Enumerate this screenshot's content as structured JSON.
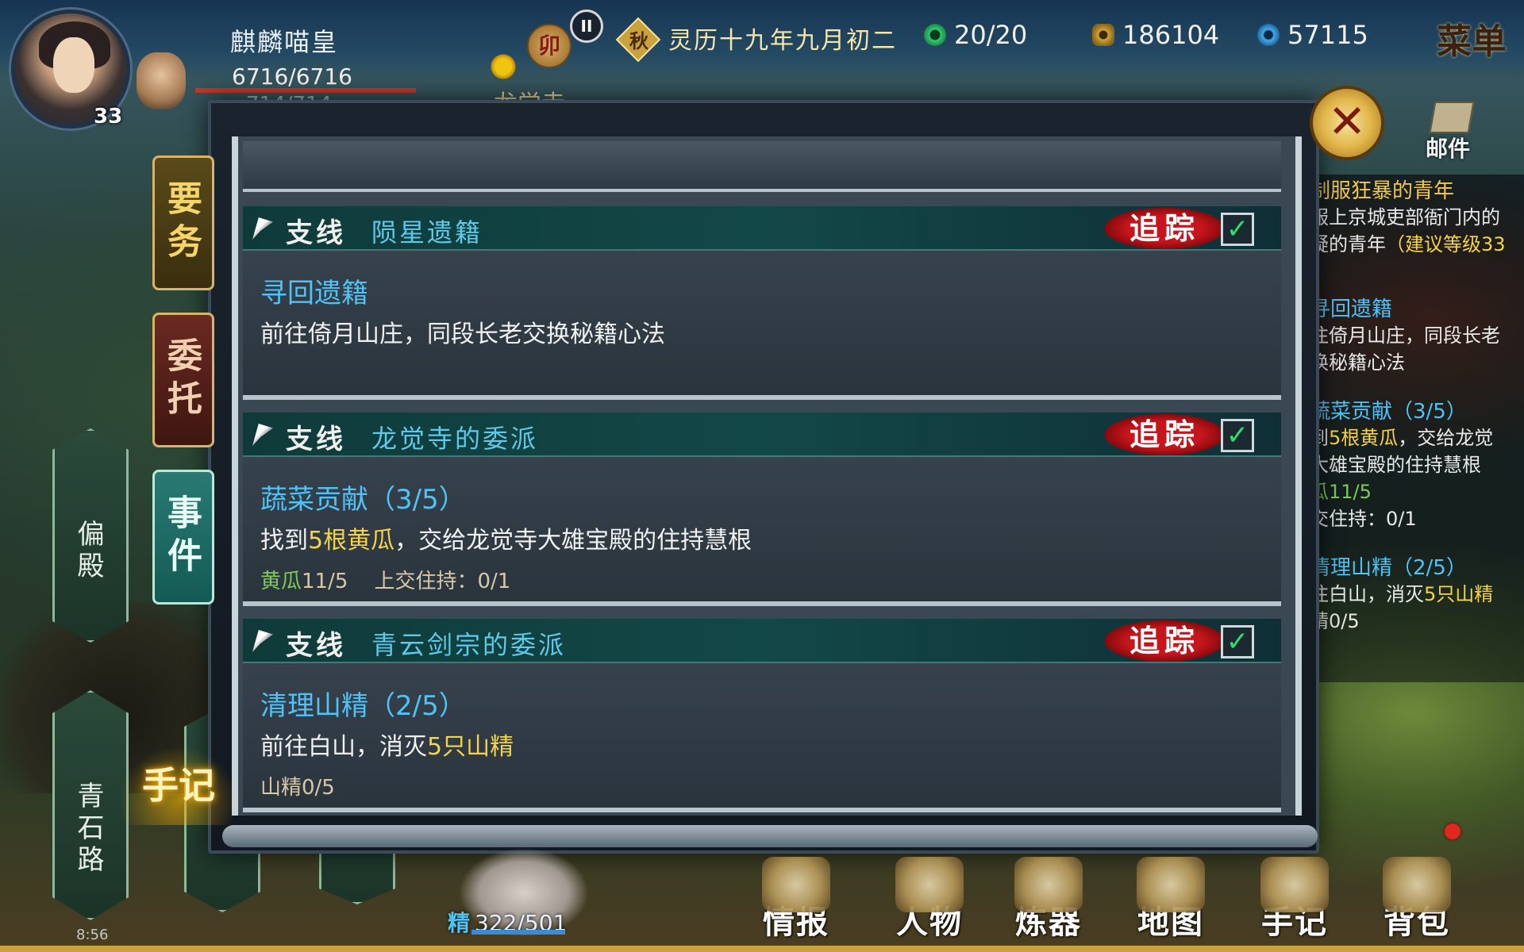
{
  "player": {
    "name": "麒麟喵皇",
    "hp": "6716/6716",
    "mp_partial": "714/714",
    "level": "33"
  },
  "header": {
    "seal_char": "卯",
    "pause_symbol": "II",
    "season_char": "秋",
    "date": "灵历十九年九月初二",
    "location_partial": "龙觉寺"
  },
  "resources": {
    "stamina": "20/20",
    "coins": "186104",
    "gems": "57115"
  },
  "menu_label": "菜单",
  "mail_label": "邮件",
  "close_symbol": "✕",
  "tabs": {
    "important": "要务",
    "commission": "委托",
    "event": "事件"
  },
  "map_markers": {
    "side_hall": "偏殿",
    "stone_road": "青石路"
  },
  "notebook_label": "手记",
  "quests": [
    {
      "branch": "支线",
      "group": "陨星遗籍",
      "track": "追踪",
      "checked": "✓",
      "title": "寻回遗籍",
      "desc_pre": "前往倚月山庄，同段长老交换秘籍心法",
      "desc_hl": "",
      "desc_post": ""
    },
    {
      "branch": "支线",
      "group": "龙觉寺的委派",
      "track": "追踪",
      "checked": "✓",
      "title": "蔬菜贡献（3/5）",
      "desc_pre": "找到",
      "desc_hl": "5根黄瓜",
      "desc_post": "，交给龙觉寺大雄宝殿的住持慧根",
      "progress_green": "黄瓜",
      "progress_a": "11/5",
      "progress_b": "上交住持：0/1"
    },
    {
      "branch": "支线",
      "group": "青云剑宗的委派",
      "track": "追踪",
      "checked": "✓",
      "title": "清理山精（2/5）",
      "desc_pre": "前往白山，消灭",
      "desc_hl": "5只山精",
      "desc_post": "",
      "progress_a": "山精0/5"
    }
  ],
  "sidebar": {
    "q0_title": "制服狂暴的青年",
    "q0_line1": "服上京城吏部衙门内的",
    "q0_line2_a": "疑的青年",
    "q0_line2_b": "（建议等级33",
    "q1_title": "寻回遗籍",
    "q1_line1": "往倚月山庄，同段长老",
    "q1_line2": "换秘籍心法",
    "q2_title": "蔬菜贡献（3/5）",
    "q2_line1_a": "到",
    "q2_line1_b": "5根黄瓜",
    "q2_line1_c": "，交给龙觉",
    "q2_line2": "大雄宝殿的住持慧根",
    "q2_line3": "瓜11/5",
    "q2_line4": "交住持：0/1",
    "q3_title": "清理山精（2/5）",
    "q3_line1_a": "往白山，消灭",
    "q3_line1_b": "5只山精",
    "q3_line2": "精0/5"
  },
  "companion": {
    "tag": "精",
    "energy": "322/501"
  },
  "bottom_nav": {
    "info": "情报",
    "character": "人物",
    "forge": "炼器",
    "map": "地图",
    "notes": "手记",
    "bag": "背包"
  },
  "status_time": "8:56"
}
